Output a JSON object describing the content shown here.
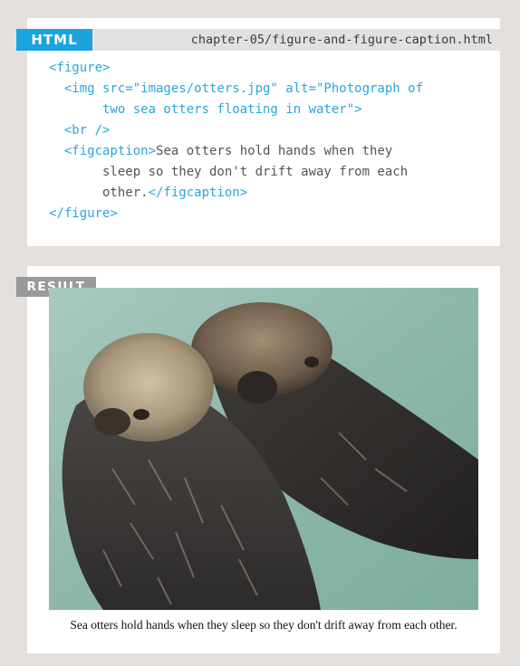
{
  "code_panel": {
    "tab_label": "HTML",
    "filename": "chapter-05/figure-and-figure-caption.html",
    "lines": [
      [
        {
          "t": "tag",
          "v": "<figure>"
        }
      ],
      [
        {
          "t": "tag",
          "v": "  <img src=\"images/otters.jpg\" alt=\"Photograph of"
        }
      ],
      [
        {
          "t": "tag",
          "v": "       two sea otters floating in water\">"
        }
      ],
      [
        {
          "t": "tag",
          "v": "  <br />"
        }
      ],
      [
        {
          "t": "tag",
          "v": "  <figcaption>"
        },
        {
          "t": "txt",
          "v": "Sea otters hold hands when they"
        }
      ],
      [
        {
          "t": "txt",
          "v": "       sleep so they don't drift away from each"
        }
      ],
      [
        {
          "t": "txt",
          "v": "       other."
        },
        {
          "t": "tag",
          "v": "</figcaption>"
        }
      ],
      [
        {
          "t": "tag",
          "v": "</figure>"
        }
      ]
    ]
  },
  "result_panel": {
    "tab_label": "RESULT",
    "caption": "Sea otters hold hands when they sleep so they don't drift away from each other."
  },
  "colors": {
    "page_background": "#e4e0dd",
    "html_tab": "#1ba3de",
    "result_tab": "#9a9a9a",
    "code_tag": "#2aa6d9"
  },
  "icons": {
    "photo": "two-sea-otters-photo"
  }
}
